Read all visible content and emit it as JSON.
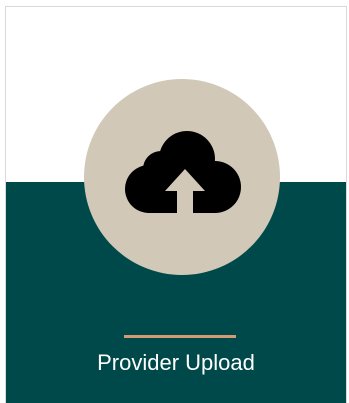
{
  "card": {
    "label": "Provider Upload",
    "icon": "cloud-upload-icon"
  },
  "colors": {
    "top_background": "#ffffff",
    "bottom_background": "#00494a",
    "circle": "#d1c8b8",
    "icon": "#000000",
    "accent": "#d39a74",
    "label_text": "#ffffff"
  }
}
